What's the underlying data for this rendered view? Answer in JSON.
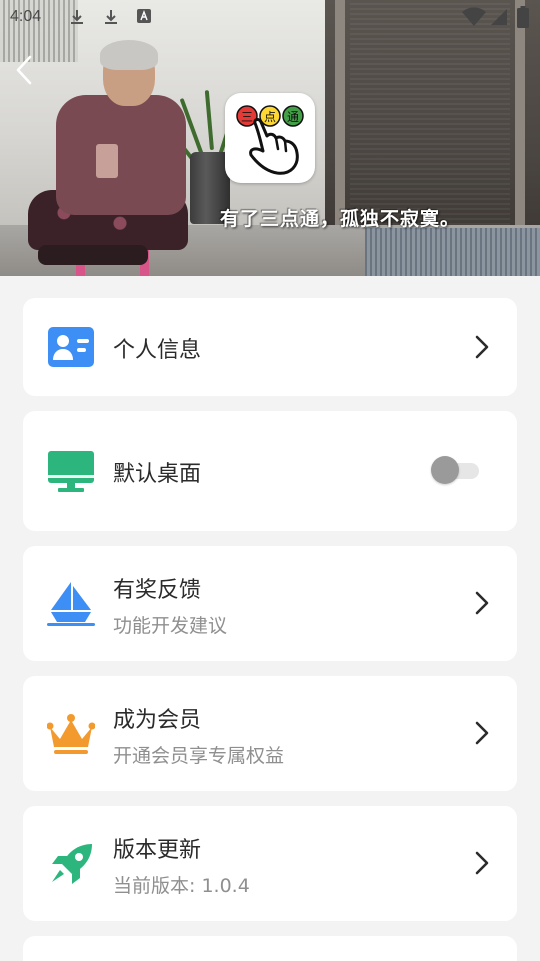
{
  "status_bar": {
    "time": "4:04"
  },
  "banner": {
    "logo_chars": [
      "三",
      "点",
      "通"
    ],
    "caption": "有了三点通，孤独不寂寞。"
  },
  "menu": [
    {
      "title": "个人信息",
      "icon": "id-card-icon",
      "color": "#3d8ef5"
    },
    {
      "title": "默认桌面",
      "icon": "monitor-icon",
      "color": "#2cb67d",
      "toggle": false
    },
    {
      "title": "有奖反馈",
      "subtitle": "功能开发建议",
      "icon": "feedback-icon",
      "color": "#3d8ef5"
    },
    {
      "title": "成为会员",
      "subtitle": "开通会员享专属权益",
      "icon": "crown-icon",
      "color": "#f39a2e"
    },
    {
      "title": "版本更新",
      "subtitle": "当前版本: 1.0.4",
      "icon": "rocket-icon",
      "color": "#2cb67d"
    }
  ]
}
